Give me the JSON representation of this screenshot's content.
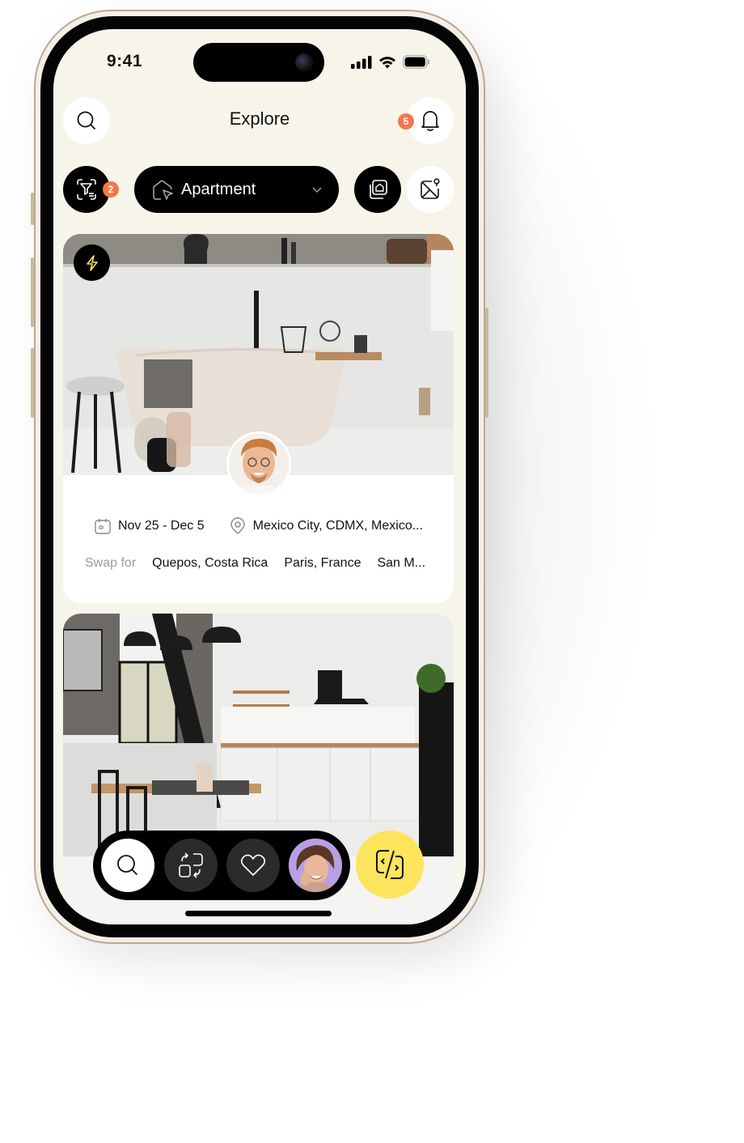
{
  "status_bar": {
    "time": "9:41",
    "icons": [
      "cellular-signal-icon",
      "wifi-icon",
      "battery-icon"
    ]
  },
  "header": {
    "title": "Explore",
    "search_icon": "search-icon",
    "notification_icon": "bell-icon",
    "notification_count": "5"
  },
  "filter_bar": {
    "filter_icon": "filter-icon",
    "filter_count": "2",
    "category": {
      "selected": "Apartment",
      "icon": "home-cursor-icon",
      "chevron": "chevron-down-icon"
    },
    "gallery_icon": "gallery-view-icon",
    "map_icon": "map-pin-icon"
  },
  "listings": [
    {
      "image_desc": "Bathroom with freestanding bathtub",
      "badge_icon": "lightning-icon",
      "host_avatar": "host-avatar",
      "dates": "Nov 25 - Dec 5",
      "location": "Mexico City, CDMX, Mexico...",
      "swap_label": "Swap for",
      "swap_destinations": [
        "Quepos, Costa Rica",
        "Paris, France",
        "San M..."
      ]
    },
    {
      "image_desc": "Loft kitchen with dining table"
    }
  ],
  "bottom_nav": {
    "items": [
      {
        "name": "explore",
        "icon": "search-icon",
        "active": true
      },
      {
        "name": "swaps",
        "icon": "swap-squares-icon",
        "active": false
      },
      {
        "name": "favorites",
        "icon": "heart-icon",
        "active": false
      },
      {
        "name": "profile",
        "icon": "profile-avatar",
        "active": false
      }
    ],
    "fab_icon": "swap-code-icon"
  },
  "colors": {
    "background": "#f7f5ea",
    "badge": "#f4774c",
    "accent_yellow": "#fce45c",
    "black": "#000000"
  }
}
